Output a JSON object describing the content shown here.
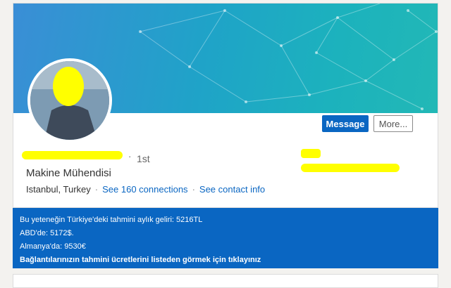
{
  "profile": {
    "degree": "1st",
    "headline": "Makine Mühendisi",
    "location": "Istanbul, Turkey",
    "connections_link": "See 160 connections",
    "contact_link": "See contact info"
  },
  "actions": {
    "message_label": "Message",
    "more_label": "More..."
  },
  "salary": {
    "line1": "Bu yeteneğin Türkiye'deki tahmini aylık geliri: 5216TL",
    "line2": "ABD'de: 5172$.",
    "line3": "Almanya'da: 9530€",
    "cta": "Bağlantılarınızın tahmini ücretlerini listeden görmek için tıklayınız"
  },
  "colors": {
    "accent": "#0a66c2",
    "redaction": "#ffff00"
  }
}
